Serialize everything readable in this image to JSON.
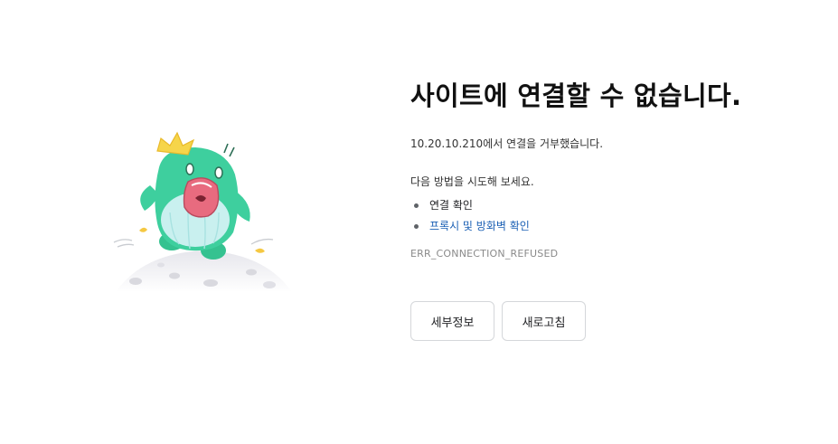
{
  "error": {
    "title": "사이트에 연결할 수 없습니다.",
    "detail": "10.20.10.210에서 연결을 거부했습니다.",
    "suggestions_heading": "다음 방법을 시도해 보세요.",
    "suggestions": [
      {
        "label": "연결 확인",
        "is_link": false
      },
      {
        "label": "프록시 및 방화벽 확인",
        "is_link": true
      }
    ],
    "code": "ERR_CONNECTION_REFUSED"
  },
  "buttons": {
    "details_label": "세부정보",
    "reload_label": "새로고침"
  },
  "illustration": {
    "icon": "screaming-mascot-with-crown-icon",
    "colors": {
      "body": "#3ecf9e",
      "belly": "#c9f0ef",
      "mouth": "#e86b7f",
      "crown": "#f6d54a",
      "planet": "#ececf0"
    }
  },
  "colors": {
    "link": "#1a5fb4",
    "error_code": "#8a8a8a",
    "button_border": "#d5d7da"
  }
}
